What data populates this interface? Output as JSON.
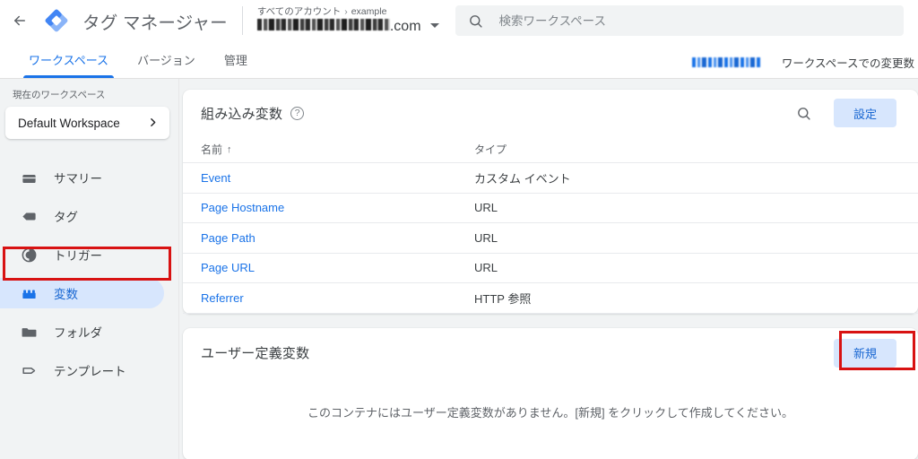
{
  "topbar": {
    "back_icon": "arrow-left-icon",
    "logo_icon": "gtm-diamond-logo",
    "app_title": "タグ マネージャー",
    "breadcrumb_root": "すべてのアカウント",
    "breadcrumb_sep": "›",
    "breadcrumb_account": "example",
    "container_name_redacted": "",
    "container_name_suffix": ".com",
    "container_dropdown_icon": "caret-down-icon",
    "search": {
      "icon": "search-icon",
      "value": "",
      "placeholder": "検索ワークスペース"
    }
  },
  "tabs": [
    {
      "label": "ワークスペース",
      "active": true
    },
    {
      "label": "バージョン",
      "active": false
    },
    {
      "label": "管理",
      "active": false
    }
  ],
  "tabbar_right": {
    "blurred_link_text": "",
    "changes_label": "ワークスペースでの変更数"
  },
  "sidebar": {
    "workspace_label": "現在のワークスペース",
    "workspace_name": "Default Workspace",
    "workspace_chevron_icon": "chevron-right-icon",
    "items": [
      {
        "label": "サマリー",
        "icon": "summary-icon",
        "selected": false
      },
      {
        "label": "タグ",
        "icon": "tag-icon",
        "selected": false
      },
      {
        "label": "トリガー",
        "icon": "trigger-icon",
        "selected": false
      },
      {
        "label": "変数",
        "icon": "variables-icon",
        "selected": true
      },
      {
        "label": "フォルダ",
        "icon": "folder-icon",
        "selected": false
      },
      {
        "label": "テンプレート",
        "icon": "template-icon",
        "selected": false
      }
    ]
  },
  "builtin_variables": {
    "title": "組み込み変数",
    "help_icon": "help-circle-icon",
    "search_icon": "search-icon",
    "settings_button": "設定",
    "columns": {
      "name": "名前",
      "sort_arrow": "↑",
      "type": "タイプ"
    },
    "rows": [
      {
        "name": "Event",
        "type": "カスタム イベント"
      },
      {
        "name": "Page Hostname",
        "type": "URL"
      },
      {
        "name": "Page Path",
        "type": "URL"
      },
      {
        "name": "Page URL",
        "type": "URL"
      },
      {
        "name": "Referrer",
        "type": "HTTP 参照"
      }
    ]
  },
  "user_defined_variables": {
    "title": "ユーザー定義変数",
    "new_button": "新規",
    "empty_message": "このコンテナにはユーザー定義変数がありません。[新規] をクリックして作成してください。"
  },
  "annotations": {
    "color": "#d81212",
    "boxes": [
      "sidebar-variables",
      "new-variable-button"
    ]
  }
}
